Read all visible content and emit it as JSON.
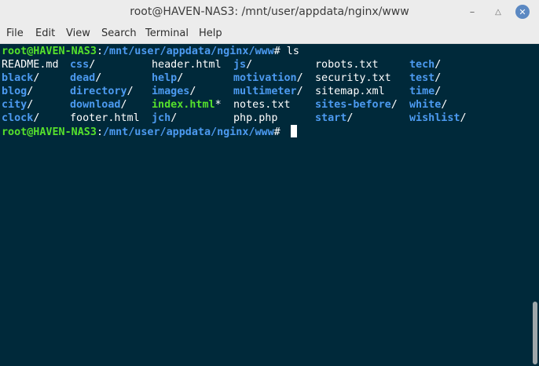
{
  "window": {
    "title": "root@HAVEN-NAS3: /mnt/user/appdata/nginx/www",
    "controls": {
      "minimize": "minimize-icon",
      "maximize": "maximize-icon",
      "close": "close-icon"
    }
  },
  "menubar": {
    "items": [
      "File",
      "Edit",
      "View",
      "Search",
      "Terminal",
      "Help"
    ]
  },
  "terminal": {
    "prompt_user": "root@HAVEN-NAS3",
    "prompt_sep": ":",
    "prompt_path": "/mnt/user/appdata/nginx/www",
    "prompt_symbol": "# ",
    "command": "ls",
    "listing": [
      {
        "name": "README.md",
        "suffix": "",
        "kind": "file"
      },
      {
        "name": "css",
        "suffix": "/",
        "kind": "dir"
      },
      {
        "name": "header.html",
        "suffix": "",
        "kind": "file"
      },
      {
        "name": "js",
        "suffix": "/",
        "kind": "dir"
      },
      {
        "name": "robots.txt",
        "suffix": "",
        "kind": "file"
      },
      {
        "name": "tech",
        "suffix": "/",
        "kind": "dir"
      },
      {
        "name": "black",
        "suffix": "/",
        "kind": "dir"
      },
      {
        "name": "dead",
        "suffix": "/",
        "kind": "dir"
      },
      {
        "name": "help",
        "suffix": "/",
        "kind": "dir"
      },
      {
        "name": "motivation",
        "suffix": "/",
        "kind": "dir"
      },
      {
        "name": "security.txt",
        "suffix": "",
        "kind": "file"
      },
      {
        "name": "test",
        "suffix": "/",
        "kind": "dir"
      },
      {
        "name": "blog",
        "suffix": "/",
        "kind": "dir"
      },
      {
        "name": "directory",
        "suffix": "/",
        "kind": "dir"
      },
      {
        "name": "images",
        "suffix": "/",
        "kind": "dir"
      },
      {
        "name": "multimeter",
        "suffix": "/",
        "kind": "dir"
      },
      {
        "name": "sitemap.xml",
        "suffix": "",
        "kind": "file"
      },
      {
        "name": "time",
        "suffix": "/",
        "kind": "dir"
      },
      {
        "name": "city",
        "suffix": "/",
        "kind": "dir"
      },
      {
        "name": "download",
        "suffix": "/",
        "kind": "dir"
      },
      {
        "name": "index.html",
        "suffix": "*",
        "kind": "exe"
      },
      {
        "name": "notes.txt",
        "suffix": "",
        "kind": "file"
      },
      {
        "name": "sites-before",
        "suffix": "/",
        "kind": "dir"
      },
      {
        "name": "white",
        "suffix": "/",
        "kind": "dir"
      },
      {
        "name": "clock",
        "suffix": "/",
        "kind": "dir"
      },
      {
        "name": "footer.html",
        "suffix": "",
        "kind": "file"
      },
      {
        "name": "jch",
        "suffix": "/",
        "kind": "dir"
      },
      {
        "name": "php.php",
        "suffix": "",
        "kind": "file"
      },
      {
        "name": "start",
        "suffix": "/",
        "kind": "dir"
      },
      {
        "name": "wishlist",
        "suffix": "/",
        "kind": "dir"
      }
    ]
  },
  "colors": {
    "background": "#00293a",
    "prompt_user": "#55e02c",
    "directory": "#4c9af0",
    "executable": "#55e02c",
    "text": "#ffffff"
  }
}
